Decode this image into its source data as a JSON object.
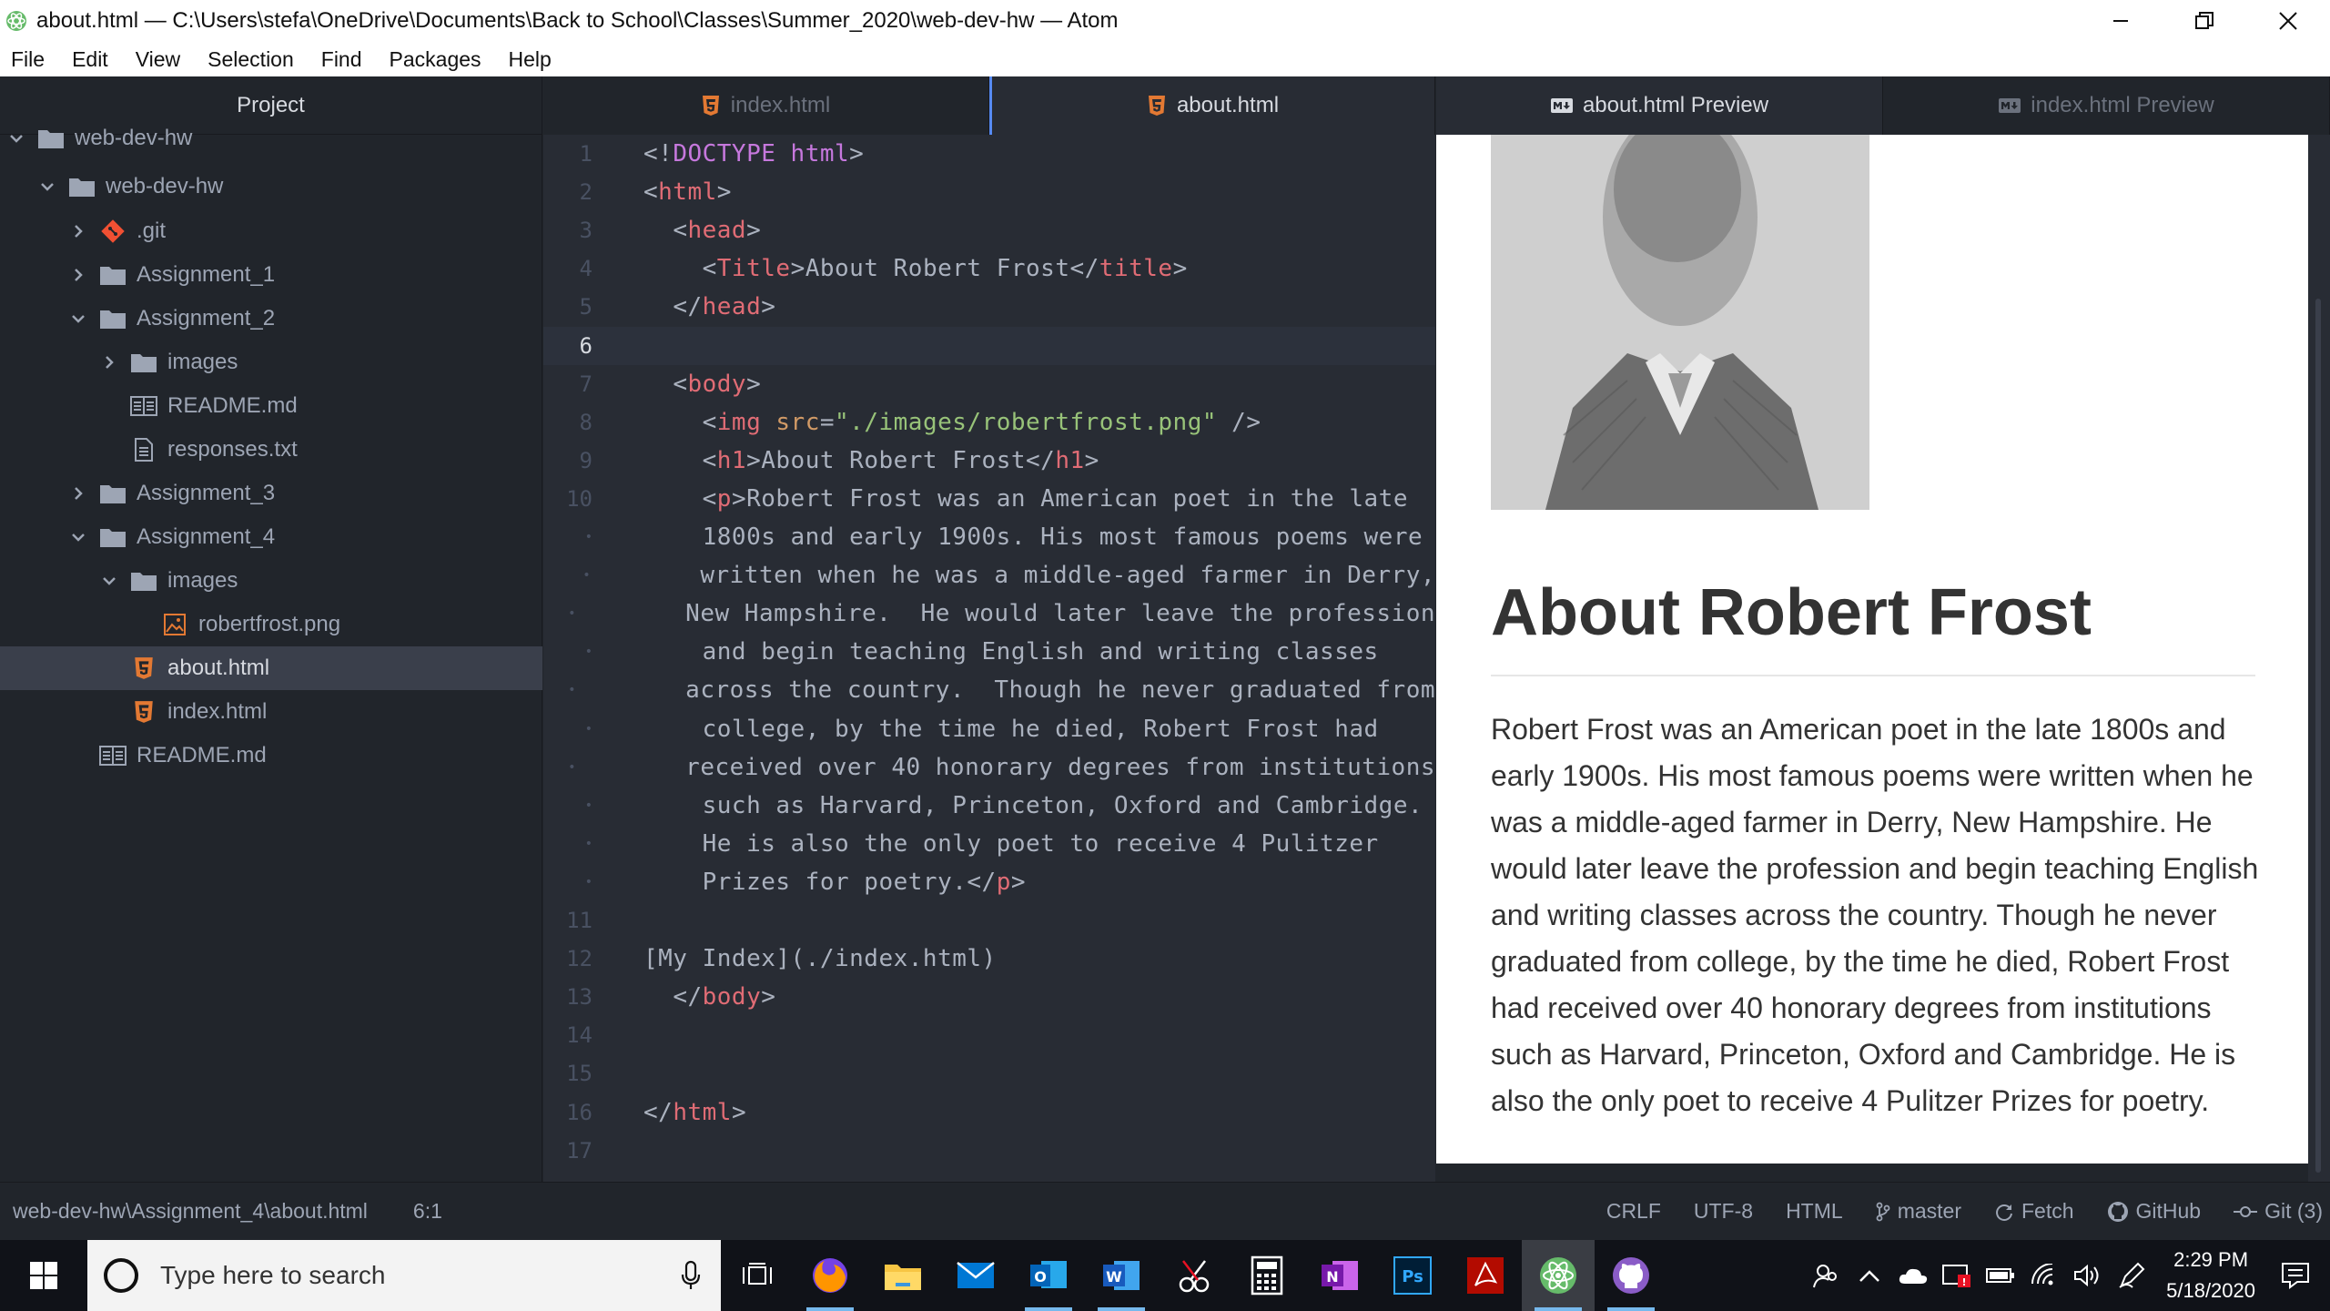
{
  "window": {
    "title": "about.html — C:\\Users\\stefa\\OneDrive\\Documents\\Back to School\\Classes\\Summer_2020\\web-dev-hw — Atom"
  },
  "menu": [
    "File",
    "Edit",
    "View",
    "Selection",
    "Find",
    "Packages",
    "Help"
  ],
  "tree": {
    "title": "Project",
    "items": [
      {
        "label": "web-dev-hw",
        "type": "folder",
        "depth": 0,
        "expanded": true
      },
      {
        "label": "web-dev-hw",
        "type": "folder",
        "depth": 1,
        "expanded": true
      },
      {
        "label": ".git",
        "type": "git",
        "depth": 2,
        "expanded": false
      },
      {
        "label": "Assignment_1",
        "type": "folder",
        "depth": 2,
        "expanded": false
      },
      {
        "label": "Assignment_2",
        "type": "folder",
        "depth": 2,
        "expanded": true
      },
      {
        "label": "images",
        "type": "folder",
        "depth": 3,
        "expanded": false
      },
      {
        "label": "README.md",
        "type": "md",
        "depth": 3
      },
      {
        "label": "responses.txt",
        "type": "txt",
        "depth": 3
      },
      {
        "label": "Assignment_3",
        "type": "folder",
        "depth": 2,
        "expanded": false
      },
      {
        "label": "Assignment_4",
        "type": "folder",
        "depth": 2,
        "expanded": true
      },
      {
        "label": "images",
        "type": "folder",
        "depth": 3,
        "expanded": true
      },
      {
        "label": "robertfrost.png",
        "type": "img",
        "depth": 4
      },
      {
        "label": "about.html",
        "type": "html",
        "depth": 3,
        "selected": true
      },
      {
        "label": "index.html",
        "type": "html",
        "depth": 3
      },
      {
        "label": "README.md",
        "type": "md",
        "depth": 2
      }
    ]
  },
  "editor": {
    "tabs": [
      {
        "label": "index.html",
        "active": false
      },
      {
        "label": "about.html",
        "active": true
      }
    ],
    "lines": [
      {
        "n": "1",
        "code": "<!DOCTYPE html>"
      },
      {
        "n": "2",
        "code": "<html>"
      },
      {
        "n": "3",
        "code": "  <head>"
      },
      {
        "n": "4",
        "code": "    <Title>About Robert Frost</title>"
      },
      {
        "n": "5",
        "code": "  </head>"
      },
      {
        "n": "6",
        "code": ""
      },
      {
        "n": "7",
        "code": "  <body>"
      },
      {
        "n": "8",
        "code": "    <img src=\"./images/robertfrost.png\" />"
      },
      {
        "n": "9",
        "code": "    <h1>About Robert Frost</h1>"
      },
      {
        "n": "10",
        "code": "    <p>Robert Frost was an American poet in the late"
      },
      {
        "n": "•",
        "code": "    1800s and early 1900s. His most famous poems were"
      },
      {
        "n": "•",
        "code": "    written when he was a middle-aged farmer in Derry,"
      },
      {
        "n": "•",
        "code": "    New Hampshire.  He would later leave the profession"
      },
      {
        "n": "•",
        "code": "    and begin teaching English and writing classes"
      },
      {
        "n": "•",
        "code": "    across the country.  Though he never graduated from"
      },
      {
        "n": "•",
        "code": "    college, by the time he died, Robert Frost had"
      },
      {
        "n": "•",
        "code": "    received over 40 honorary degrees from institutions"
      },
      {
        "n": "•",
        "code": "    such as Harvard, Princeton, Oxford and Cambridge."
      },
      {
        "n": "•",
        "code": "    He is also the only poet to receive 4 Pulitzer"
      },
      {
        "n": "•",
        "code": "    Prizes for poetry.</p>"
      },
      {
        "n": "11",
        "code": ""
      },
      {
        "n": "12",
        "code": "[My Index](./index.html)"
      },
      {
        "n": "13",
        "code": "  </body>"
      },
      {
        "n": "14",
        "code": ""
      },
      {
        "n": "15",
        "code": ""
      },
      {
        "n": "16",
        "code": "</html>"
      },
      {
        "n": "17",
        "code": ""
      }
    ],
    "cursor_line": "6"
  },
  "preview": {
    "tabs": [
      {
        "label": "about.html Preview",
        "active": true
      },
      {
        "label": "index.html Preview",
        "active": false
      }
    ],
    "heading": "About Robert Frost",
    "paragraph": "Robert Frost was an American poet in the late 1800s and early 1900s. His most famous poems were written when he was a middle-aged farmer in Derry, New Hampshire. He would later leave the profession and begin teaching English and writing classes across the country. Though he never graduated from college, by the time he died, Robert Frost had received over 40 honorary degrees from institutions such as Harvard, Princeton, Oxford and Cambridge. He is also the only poet to receive 4 Pulitzer Prizes for poetry."
  },
  "status": {
    "path": "web-dev-hw\\Assignment_4\\about.html",
    "position": "6:1",
    "line_ending": "CRLF",
    "encoding": "UTF-8",
    "grammar": "HTML",
    "branch": "master",
    "fetch": "Fetch",
    "github": "GitHub",
    "git": "Git (3)"
  },
  "taskbar": {
    "search_placeholder": "Type here to search",
    "time": "2:29 PM",
    "date": "5/18/2020"
  },
  "colors": {
    "accent": "#568af2",
    "html_icon": "#e37933",
    "git_icon": "#f05033"
  }
}
